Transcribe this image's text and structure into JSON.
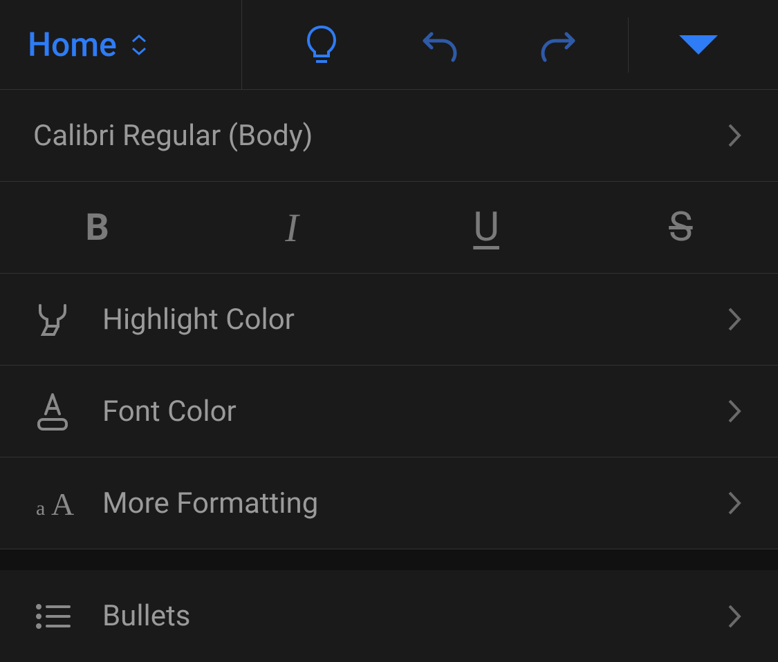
{
  "toolbar": {
    "activeTab": "Home"
  },
  "font": {
    "current": "Calibri Regular (Body)"
  },
  "formatButtons": {
    "bold": "B",
    "italic": "I",
    "underline": "U",
    "strikethrough": "S"
  },
  "rows": {
    "highlightColor": "Highlight Color",
    "fontColor": "Font Color",
    "moreFormatting": "More Formatting",
    "bullets": "Bullets"
  }
}
